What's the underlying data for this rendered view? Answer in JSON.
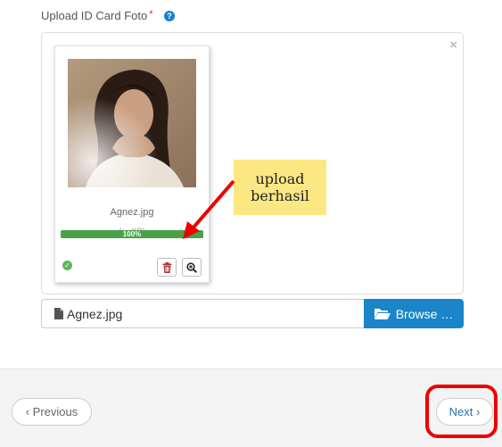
{
  "field": {
    "label": "Upload ID Card Foto",
    "required_mark": "*",
    "help_icon": "question-circle-icon"
  },
  "preview": {
    "close_symbol": "×",
    "file": {
      "name": "Agnez.jpg",
      "size_text": "(… KB)",
      "progress_percent": 100,
      "progress_text": "100%",
      "status_icon": "check-circle-icon"
    },
    "actions": {
      "delete_icon": "trash-icon",
      "zoom_icon": "zoom-in-icon"
    }
  },
  "annotation": {
    "line1": "upload",
    "line2": "berhasil",
    "note_color": "#fbe883",
    "arrow_color": "#e00000"
  },
  "file_input": {
    "value": "Agnez.jpg",
    "browse_label": "Browse …",
    "browse_color": "#1a85c8"
  },
  "footer": {
    "previous_label": "‹ Previous",
    "next_label": "Next ›",
    "highlight_color": "#e00000"
  }
}
